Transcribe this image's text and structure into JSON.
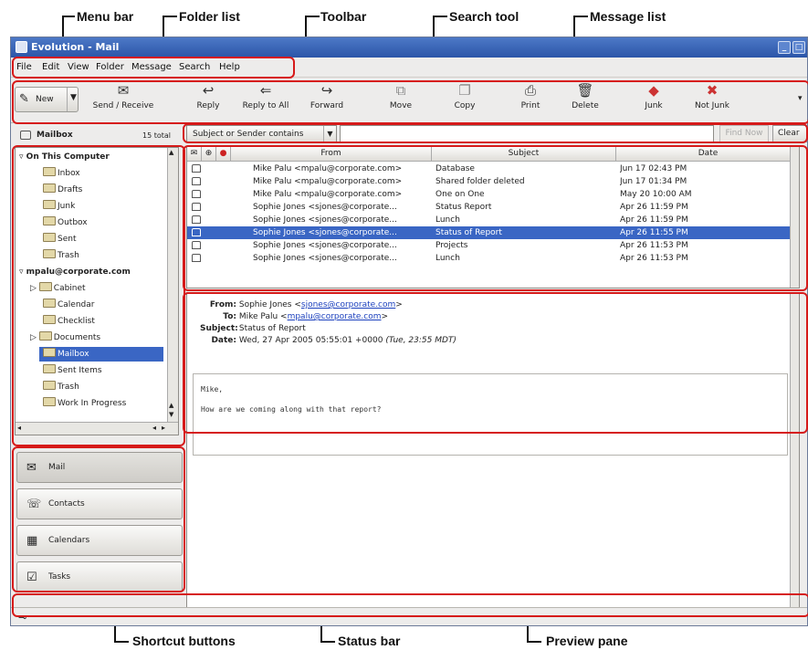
{
  "callouts": {
    "menu_bar": "Menu bar",
    "folder_list": "Folder list",
    "toolbar": "Toolbar",
    "search_tool": "Search tool",
    "message_list": "Message list",
    "shortcut_buttons": "Shortcut buttons",
    "status_bar": "Status bar",
    "preview_pane": "Preview pane"
  },
  "window": {
    "title": "Evolution - Mail"
  },
  "menu": {
    "file": "File",
    "edit": "Edit",
    "view": "View",
    "folder": "Folder",
    "message": "Message",
    "search": "Search",
    "help": "Help"
  },
  "toolbar": {
    "new": "New",
    "send_receive": "Send / Receive",
    "reply": "Reply",
    "reply_all": "Reply to All",
    "forward": "Forward",
    "move": "Move",
    "copy": "Copy",
    "print": "Print",
    "delete": "Delete",
    "junk": "Junk",
    "not_junk": "Not Junk"
  },
  "sidebar": {
    "header_title": "Mailbox",
    "header_count": "15 total",
    "sections": [
      {
        "label": "On This Computer"
      },
      {
        "label": "mpalu@corporate.com"
      }
    ],
    "local_folders": [
      "Inbox",
      "Drafts",
      "Junk",
      "Outbox",
      "Sent",
      "Trash"
    ],
    "remote_folders": [
      "Cabinet",
      "Calendar",
      "Checklist",
      "Documents",
      "Mailbox",
      "Sent Items",
      "Trash",
      "Work In Progress"
    ],
    "selected_folder": "Mailbox"
  },
  "shortcuts": {
    "mail": "Mail",
    "contacts": "Contacts",
    "calendars": "Calendars",
    "tasks": "Tasks"
  },
  "search": {
    "scope": "Subject or Sender contains",
    "query": "",
    "find_now": "Find Now",
    "clear": "Clear"
  },
  "message_list": {
    "columns": [
      "From",
      "Subject",
      "Date"
    ],
    "rows": [
      {
        "from": "Mike Palu <mpalu@corporate.com>",
        "subject": "Database",
        "date": "Jun 17 02:43 PM"
      },
      {
        "from": "Mike Palu <mpalu@corporate.com>",
        "subject": "Shared folder deleted",
        "date": "Jun 17 01:34 PM"
      },
      {
        "from": "Mike Palu <mpalu@corporate.com>",
        "subject": "One on One",
        "date": "May 20 10:00 AM"
      },
      {
        "from": "Sophie Jones <sjones@corporate...",
        "subject": "Status Report",
        "date": "Apr 26 11:59 PM"
      },
      {
        "from": "Sophie Jones <sjones@corporate...",
        "subject": "Lunch",
        "date": "Apr 26 11:59 PM"
      },
      {
        "from": "Sophie Jones <sjones@corporate...",
        "subject": "Status of Report",
        "date": "Apr 26 11:55 PM"
      },
      {
        "from": "Sophie Jones <sjones@corporate...",
        "subject": "Projects",
        "date": "Apr 26 11:53 PM"
      },
      {
        "from": "Sophie Jones <sjones@corporate...",
        "subject": "Lunch",
        "date": "Apr 26 11:53 PM"
      }
    ],
    "selected_index": 5
  },
  "preview": {
    "from_label": "From:",
    "from_name": "Sophie Jones <",
    "from_email": "sjones@corporate.com",
    "from_end": ">",
    "to_label": "To:",
    "to_name": "Mike Palu <",
    "to_email": "mpalu@corporate.com",
    "to_end": ">",
    "subject_label": "Subject:",
    "subject": "Status of Report",
    "date_label": "Date:",
    "date": "Wed, 27 Apr 2005 05:55:01 +0000",
    "date_local": "(Tue, 23:55 MDT)",
    "greeting": "Mike,",
    "body": "How are we coming along with that report?"
  },
  "colors": {
    "highlight": "#d61a1a",
    "selection": "#3a66c4",
    "titlebar": "#2b55a8"
  }
}
